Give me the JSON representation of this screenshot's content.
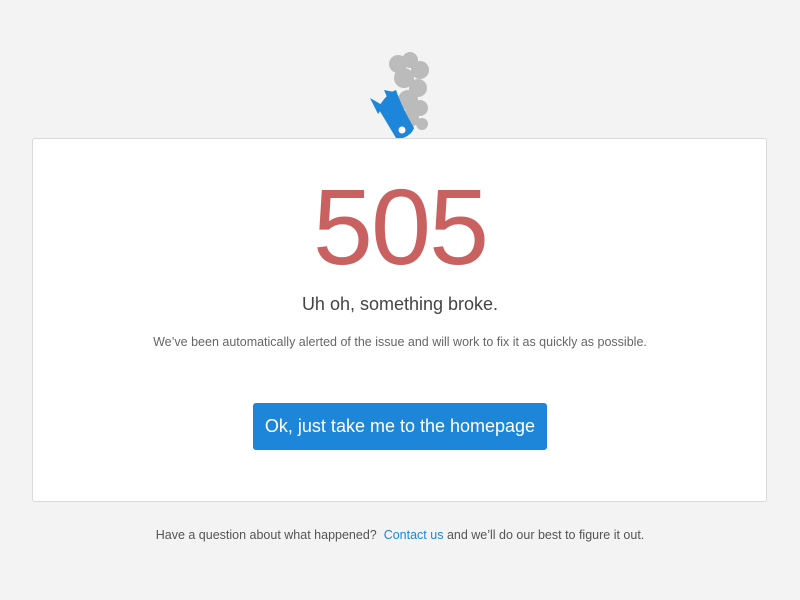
{
  "error": {
    "code": "505",
    "headline": "Uh oh, something broke.",
    "message": "We’ve been automatically alerted of the issue and will work to fix it as quickly as possible."
  },
  "actions": {
    "home_button_label": "Ok, just take me to the homepage"
  },
  "footer": {
    "prefix": "Have a question about what happened?",
    "contact_link_label": "Contact us",
    "suffix": "and we’ll do our best to figure it out."
  },
  "illustration": {
    "icon": "crashed-rocket-icon",
    "rocket_color": "#1e86d9",
    "smoke_color": "#a8a8a8"
  },
  "colors": {
    "error_code": "#c8615f",
    "accent": "#1e86d9",
    "background": "#f3f3f3",
    "card": "#ffffff"
  }
}
